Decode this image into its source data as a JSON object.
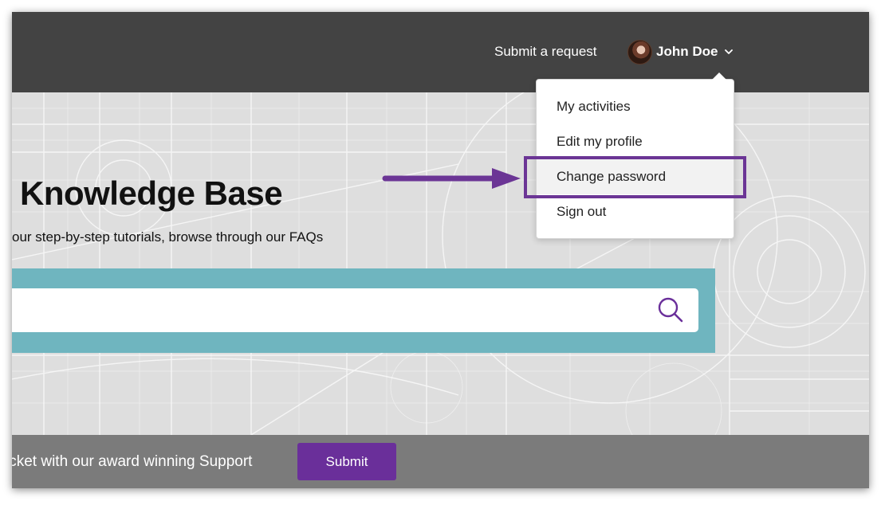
{
  "header": {
    "submit_request_label": "Submit a request",
    "user_name": "John Doe",
    "avatar_icon": "user-avatar-photo",
    "chevron_icon": "chevron-down-icon"
  },
  "user_menu": {
    "items": [
      {
        "label": "My activities"
      },
      {
        "label": "Edit my profile"
      },
      {
        "label": "Change password"
      },
      {
        "label": "Sign out"
      }
    ],
    "highlighted_item": "Change password"
  },
  "hero": {
    "title": "Knowledge Base",
    "subtitle": "our step-by-step tutorials, browse through our FAQs"
  },
  "search": {
    "value": "",
    "placeholder": "",
    "icon": "search-icon"
  },
  "footer_bar": {
    "text": "icket with our award winning Support",
    "submit_label": "Submit"
  },
  "annotation": {
    "arrow_icon": "right-arrow-icon"
  },
  "colors": {
    "header_bg": "#434343",
    "search_band": "#6fb5bf",
    "accent_purple": "#6a2f9a",
    "footer_bar": "#7b7b7b"
  }
}
